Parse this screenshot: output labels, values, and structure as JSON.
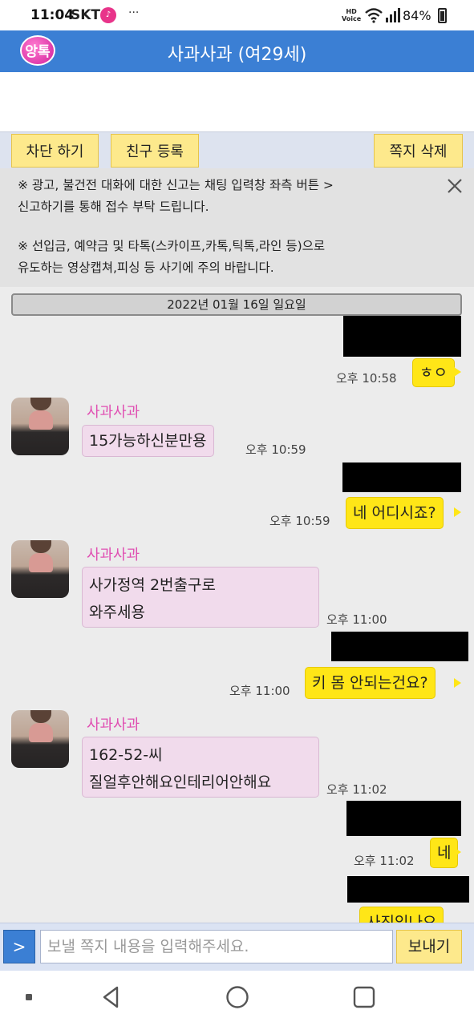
{
  "status_bar": {
    "time": "11:04",
    "carrier": "SKT",
    "more": "···",
    "network_badge": "HD Voice",
    "battery_percent": "84%"
  },
  "app_bar": {
    "logo_text": "앙톡",
    "title": "사과사과 (여29세)",
    "colors": {
      "background": "#3b7fd4",
      "logo": "#e8348a"
    }
  },
  "toolbar": {
    "block_label": "차단 하기",
    "add_friend_label": "친구 등록",
    "delete_label": "쪽지 삭제"
  },
  "notice": {
    "line1": "※ 광고, 불건전 대화에 대한 신고는 채팅 입력창 좌측 버튼 >",
    "line2": "신고하기를 통해 접수 부탁 드립니다.",
    "line3": "※ 선입금, 예약금 및 타톡(스카이프,카톡,틱톡,라인 등)으로",
    "line4": "유도하는 영상캡쳐,피싱 등 사기에 주의 바랍니다."
  },
  "date_separator": "2022년 01월 16일 일요일",
  "messages": [
    {
      "from": "me",
      "text": "ㅎㅇ",
      "time": "오후 10:58"
    },
    {
      "from": "partner",
      "sender": "사과사과",
      "text": "15가능하신분만용",
      "time": "오후 10:59"
    },
    {
      "from": "me",
      "text": "네 어디시죠?",
      "time": "오후 10:59"
    },
    {
      "from": "partner",
      "sender": "사과사과",
      "text_line1": "사가정역 2번출구로",
      "text_line2": "와주세용",
      "time": "오후 11:00"
    },
    {
      "from": "me",
      "text": "키 몸 안되는건요?",
      "time": "오후 11:00"
    },
    {
      "from": "partner",
      "sender": "사과사과",
      "text_line1": "162-52-씨",
      "text_line2": "질얼후안해요인테리어안해요",
      "time": "오후 11:02"
    },
    {
      "from": "me",
      "text": "네",
      "time": "오후 11:02"
    },
    {
      "from": "me",
      "text": "사진있나요"
    }
  ],
  "input_bar": {
    "menu_label": ">",
    "placeholder": "보낼 쪽지 내용을 입력해주세요.",
    "send_label": "보내기"
  },
  "nav_bar": {
    "icons": [
      "recent-apps-icon",
      "back-icon",
      "home-icon",
      "overview-icon"
    ]
  }
}
